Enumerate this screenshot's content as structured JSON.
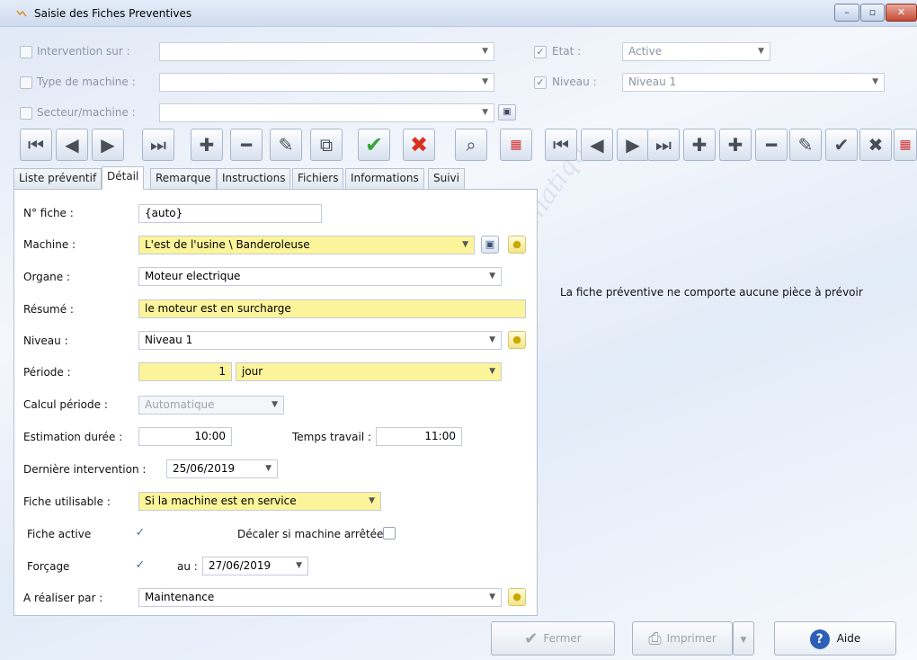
{
  "window": {
    "title": "Saisie des Fiches Preventives",
    "controls": {
      "minimize": "–",
      "maximize": "▫",
      "close": "✕"
    }
  },
  "filters": {
    "intervention_label": "Intervention sur :",
    "type_machine_label": "Type de machine :",
    "secteur_label": "Secteur/machine :",
    "etat_label": "Etat :",
    "etat_value": "Active",
    "niveau_label": "Niveau :",
    "niveau_value": "Niveau 1"
  },
  "tabs": [
    "Liste préventif",
    "Détail",
    "Remarque",
    "Instructions",
    "Fichiers",
    "Informations",
    "Suivi"
  ],
  "active_tab": "Détail",
  "form": {
    "num_fiche_label": "N° fiche :",
    "num_fiche_value": "{auto}",
    "machine_label": "Machine :",
    "machine_value": "L'est de l'usine \\ Banderoleuse",
    "organe_label": "Organe :",
    "organe_value": "Moteur electrique",
    "resume_label": "Résumé :",
    "resume_value": "le moteur est en surcharge",
    "niveau_label": "Niveau :",
    "niveau_value": "Niveau 1",
    "periode_label": "Période :",
    "periode_value": "1",
    "periode_unit": "jour",
    "calcul_label": "Calcul période :",
    "calcul_value": "Automatique",
    "estimation_label": "Estimation durée :",
    "estimation_value": "10:00",
    "temps_label": "Temps travail :",
    "temps_value": "11:00",
    "derniere_label": "Dernière intervention :",
    "derniere_value": "25/06/2019",
    "utilisable_label": "Fiche utilisable :",
    "utilisable_value": "Si la machine est en service",
    "active_label": "Fiche active",
    "decaler_label": "Décaler si machine arrêtée",
    "forcage_label": "Forçage",
    "au_label": "au :",
    "forcage_date": "27/06/2019",
    "realiser_label": "A réaliser par :",
    "realiser_value": "Maintenance"
  },
  "right_panel": {
    "message": "La fiche préventive ne comporte aucune pièce à prévoir"
  },
  "buttons": {
    "fermer": "Fermer",
    "imprimer": "Imprimer",
    "aide": "Aide"
  },
  "watermark_text": "AS-Informatique",
  "icons": {
    "first": "first-record-icon",
    "prev": "previous-record-icon",
    "next": "next-record-icon",
    "last": "last-record-icon",
    "add": "add-icon",
    "remove": "remove-icon",
    "edit": "edit-tool-icon",
    "duplicate": "duplicate-icon",
    "validate": "validate-icon",
    "cancel": "cancel-icon",
    "search": "search-icon",
    "grid": "grid-icon"
  },
  "colors": {
    "highlight_yellow": "#fbf49a",
    "validate_green": "#3aa33a",
    "cancel_red": "#d83020",
    "help_blue": "#2d5fb8"
  }
}
